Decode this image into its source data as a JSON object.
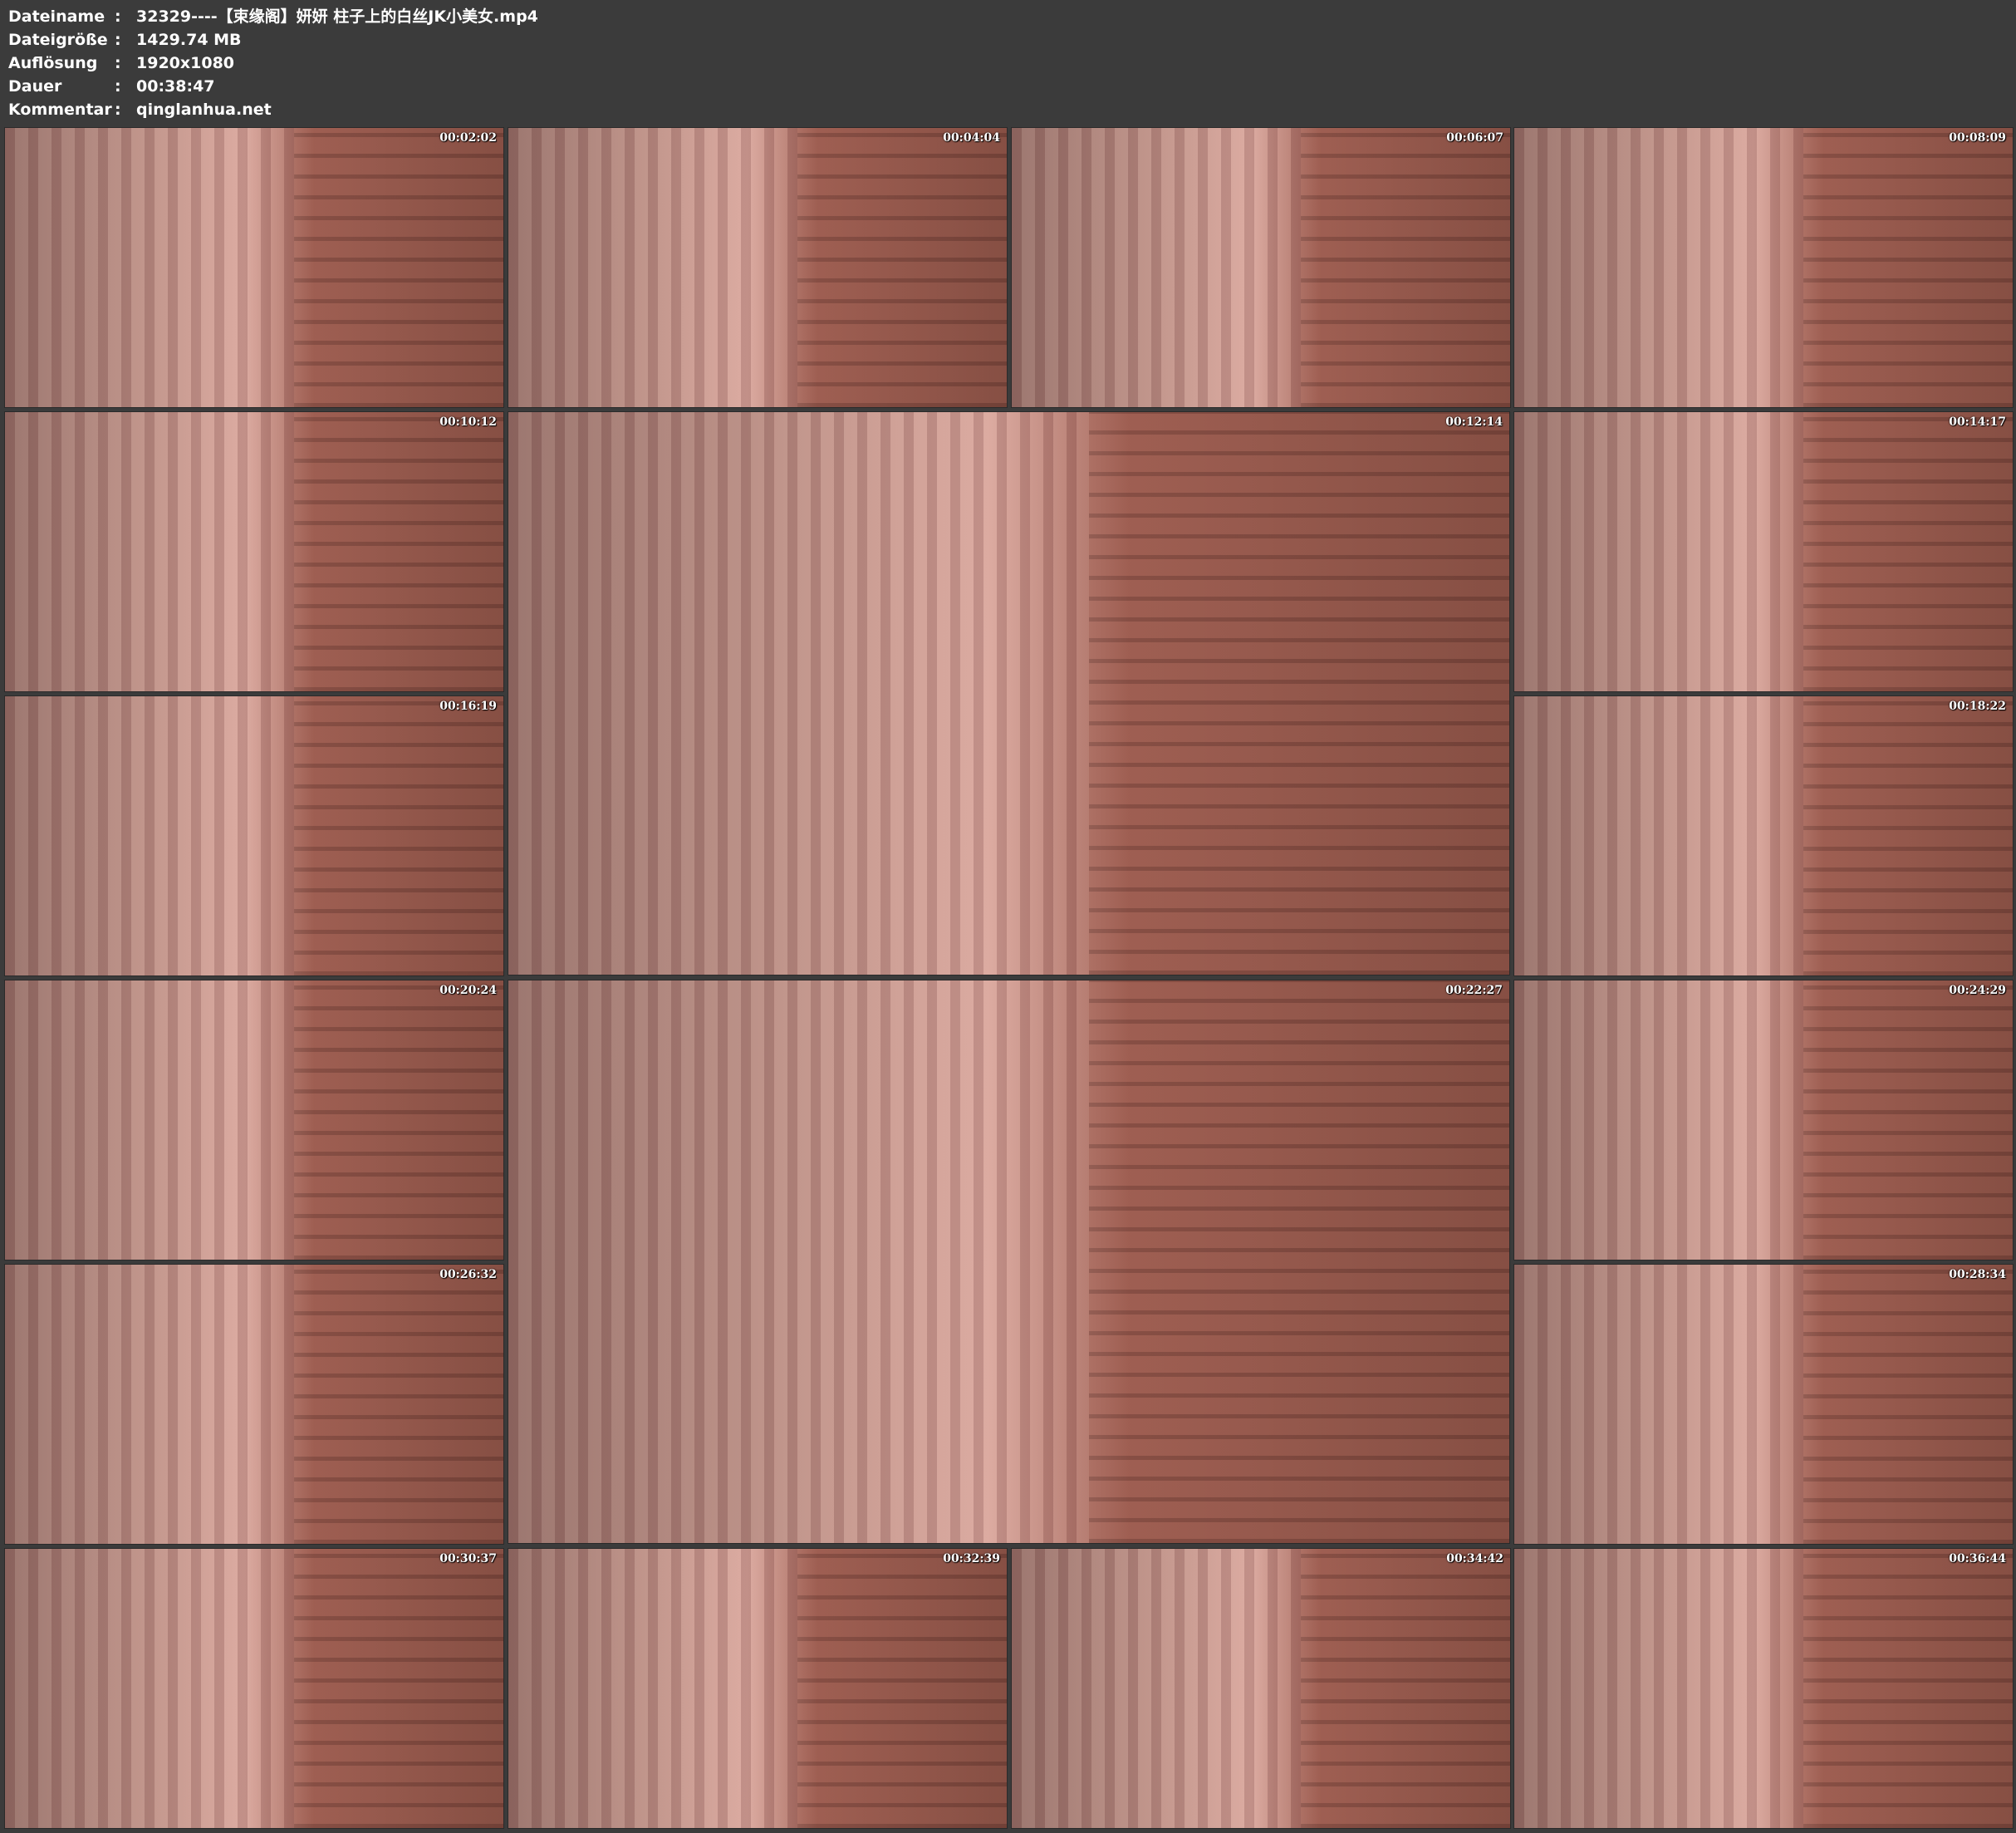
{
  "file_info": [
    {
      "label": "Dateiname",
      "value": "32329----【束缘阁】妍妍 柱子上的白丝JK小美女.mp4"
    },
    {
      "label": "Dateigröße",
      "value": "1429.74 MB"
    },
    {
      "label": "Auflösung",
      "value": "1920x1080"
    },
    {
      "label": "Dauer",
      "value": "00:38:47"
    },
    {
      "label": "Kommentar",
      "value": "qinglanhua.net"
    }
  ],
  "separator": ":",
  "thumbnails": [
    "00:02:02",
    "00:04:04",
    "00:06:07",
    "00:08:09",
    "00:10:12",
    "00:12:14",
    "00:14:17",
    "00:16:19",
    "00:18:22",
    "00:20:24",
    "00:22:27",
    "00:24:29",
    "00:26:32",
    "00:28:34",
    "00:30:37",
    "00:32:39",
    "00:34:42",
    "00:36:44"
  ]
}
